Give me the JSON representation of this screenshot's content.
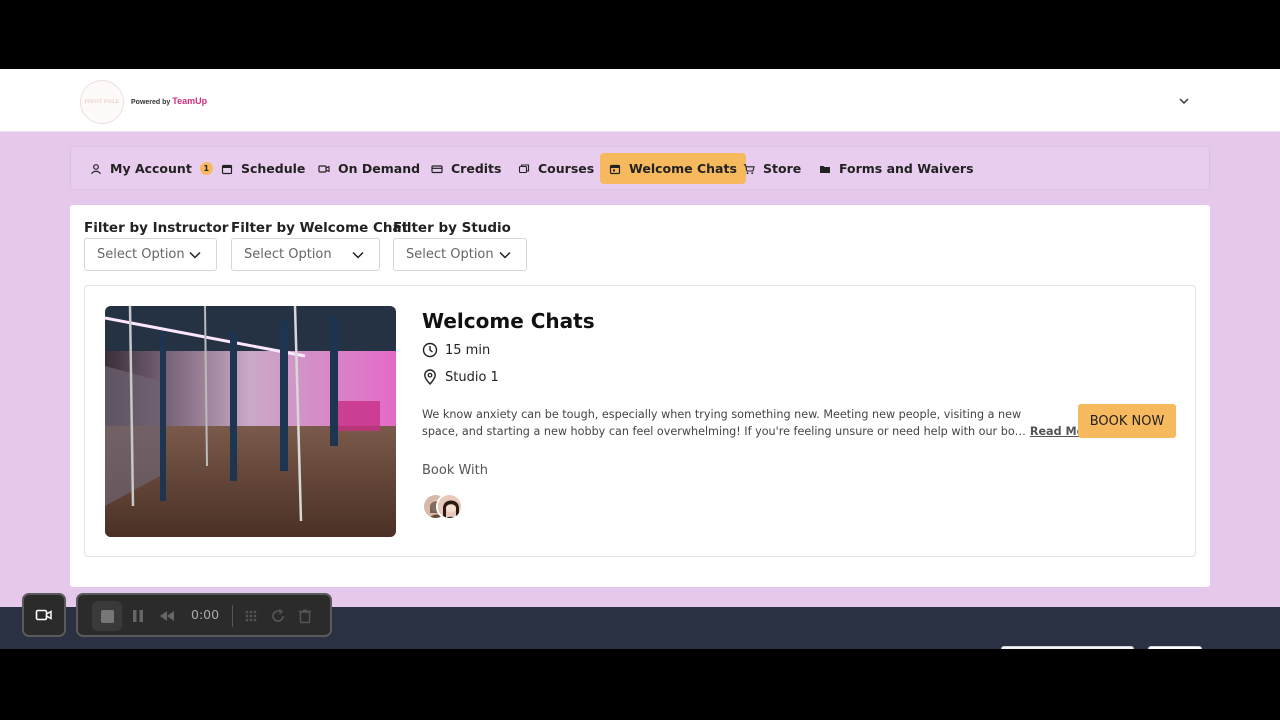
{
  "header": {
    "logo_text": "PIVOT POLE",
    "powered_by": "Powered by",
    "brand": "TeamUp"
  },
  "nav": {
    "items": [
      {
        "label": "My Account",
        "icon": "user-icon",
        "badge": "1"
      },
      {
        "label": "Schedule",
        "icon": "calendar-icon"
      },
      {
        "label": "On Demand",
        "icon": "video-icon"
      },
      {
        "label": "Credits",
        "icon": "ticket-icon"
      },
      {
        "label": "Courses",
        "icon": "courses-icon"
      },
      {
        "label": "Welcome Chats",
        "icon": "calendar-icon",
        "active": true
      },
      {
        "label": "Store",
        "icon": "cart-icon"
      },
      {
        "label": "Forms and Waivers",
        "icon": "folder-icon"
      }
    ]
  },
  "filters": [
    {
      "label": "Filter by Instructor",
      "placeholder": "Select Option"
    },
    {
      "label": "Filter by Welcome Chat",
      "placeholder": "Select Option"
    },
    {
      "label": "Filter by Studio",
      "placeholder": "Select Option"
    }
  ],
  "card": {
    "title": "Welcome Chats",
    "duration": "15 min",
    "location": "Studio 1",
    "description_line1": "We know anxiety can be tough, especially when trying something new. Meeting new people, visiting a new",
    "description_line2": "space, and starting a new hobby can feel overwhelming! If you're feeling unsure or need help with our bo…",
    "read_more": "Read More",
    "book_with": "Book With",
    "book_now": "BOOK NOW"
  },
  "recorder": {
    "time": "0:00"
  },
  "colors": {
    "accent": "#f6b95e",
    "page_bg": "#e6c8ec",
    "footer": "#2a3142"
  }
}
